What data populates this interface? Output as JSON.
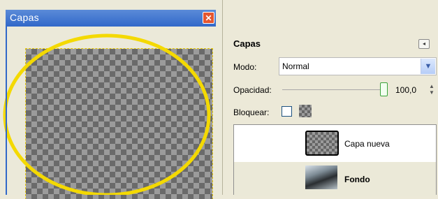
{
  "dock": {
    "title": "Capas",
    "close_glyph": "✕"
  },
  "panel": {
    "heading": "Capas",
    "menu_icon": "panel-menu-icon",
    "mode_label": "Modo:",
    "mode_value": "Normal",
    "opacity_label": "Opacidad:",
    "opacity_value": "100,0",
    "opacity_fraction": 1.0,
    "lock_label": "Bloquear:"
  },
  "layers": [
    {
      "name": "Capa nueva",
      "selected": true
    },
    {
      "name": "Fondo",
      "selected": false
    }
  ],
  "colors": {
    "titlebar": "#3168c9",
    "highlight_circle": "#f4d900",
    "selection_dashes": "#e6c800"
  }
}
